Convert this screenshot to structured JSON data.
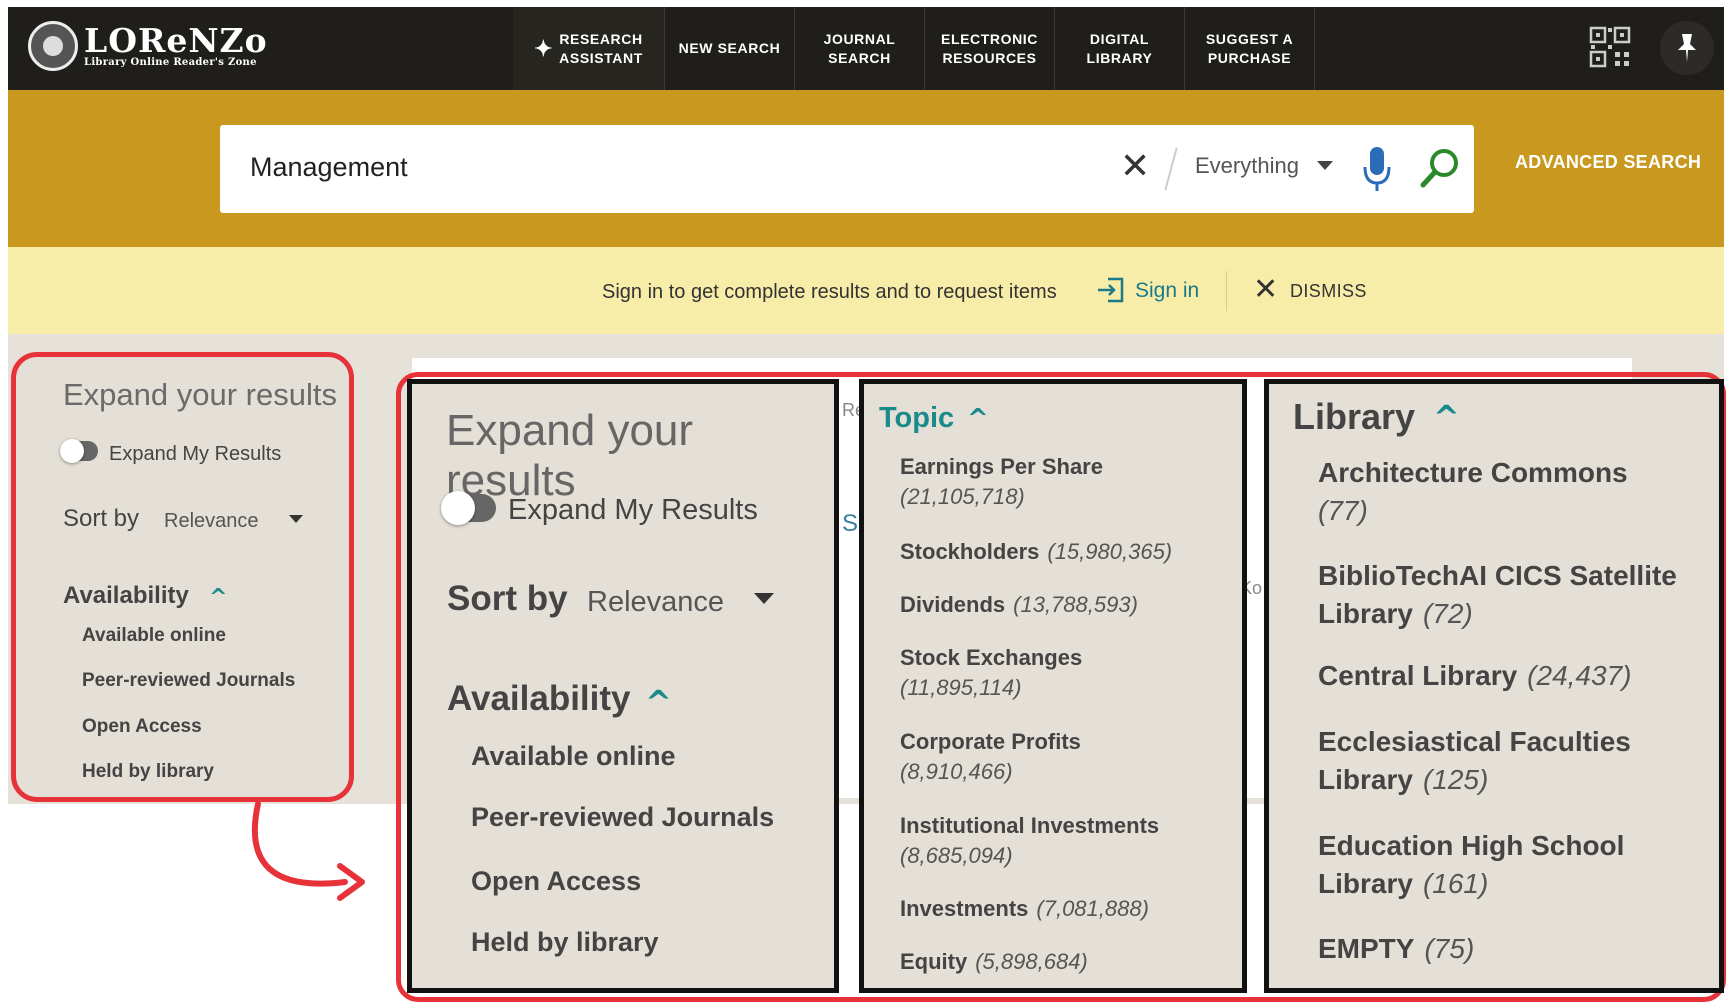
{
  "app": {
    "logo_name": "LOReNZo",
    "logo_tagline": "Library Online Reader's Zone"
  },
  "nav": {
    "items": [
      {
        "label": "RESEARCH\nASSISTANT",
        "icon": "sparkle-icon"
      },
      {
        "label": "NEW SEARCH"
      },
      {
        "label": "JOURNAL\nSEARCH"
      },
      {
        "label": "ELECTRONIC\nRESOURCES"
      },
      {
        "label": "DIGITAL\nLIBRARY"
      },
      {
        "label": "SUGGEST A\nPURCHASE"
      }
    ]
  },
  "search": {
    "value": "Management",
    "scope": "Everything",
    "advanced_label": "ADVANCED SEARCH"
  },
  "signin_banner": {
    "message": "Sign in to get complete results and to request items",
    "signin_label": "Sign in",
    "dismiss_label": "DISMISS"
  },
  "left_panel": {
    "title": "Expand your results",
    "toggle_label": "Expand My Results",
    "sort_by_label": "Sort by",
    "sort_value": "Relevance",
    "availability_label": "Availability",
    "availability_items": [
      "Available online",
      "Peer-reviewed Journals",
      "Open Access",
      "Held by library"
    ]
  },
  "zoom_panel_1": {
    "title": "Expand your results",
    "toggle_label": "Expand My Results",
    "sort_by_label": "Sort by",
    "sort_value": "Relevance",
    "availability_label": "Availability",
    "availability_items": [
      "Available online",
      "Peer-reviewed Journals",
      "Open Access",
      "Held by library"
    ]
  },
  "topic_panel": {
    "title": "Topic",
    "items": [
      {
        "name": "Earnings Per Share",
        "count": "(21,105,718)"
      },
      {
        "name": "Stockholders",
        "count": "(15,980,365)"
      },
      {
        "name": "Dividends",
        "count": "(13,788,593)"
      },
      {
        "name": "Stock Exchanges",
        "count": "(11,895,114)"
      },
      {
        "name": "Corporate Profits",
        "count": "(8,910,466)"
      },
      {
        "name": "Institutional Investments",
        "count": "(8,685,094)"
      },
      {
        "name": "Investments",
        "count": "(7,081,888)"
      },
      {
        "name": "Equity",
        "count": "(5,898,684)"
      }
    ]
  },
  "library_panel": {
    "title": "Library",
    "items": [
      {
        "name": "Architecture Commons",
        "count": "(77)"
      },
      {
        "name": "BiblioTechAI CICS Satellite Library",
        "count": "(72)"
      },
      {
        "name": "Central Library",
        "count": "(24,437)"
      },
      {
        "name": "Ecclesiastical Faculties Library",
        "count": "(125)"
      },
      {
        "name": "Education High School Library",
        "count": "(161)"
      },
      {
        "name": "EMPTY",
        "count": "(75)"
      }
    ]
  },
  "colors": {
    "nav_bg": "#1f1e1a",
    "search_band": "#c8991e",
    "signin_band": "#f7eda9",
    "accent_teal": "#1a8a8a",
    "highlight_red": "#e8323a"
  }
}
